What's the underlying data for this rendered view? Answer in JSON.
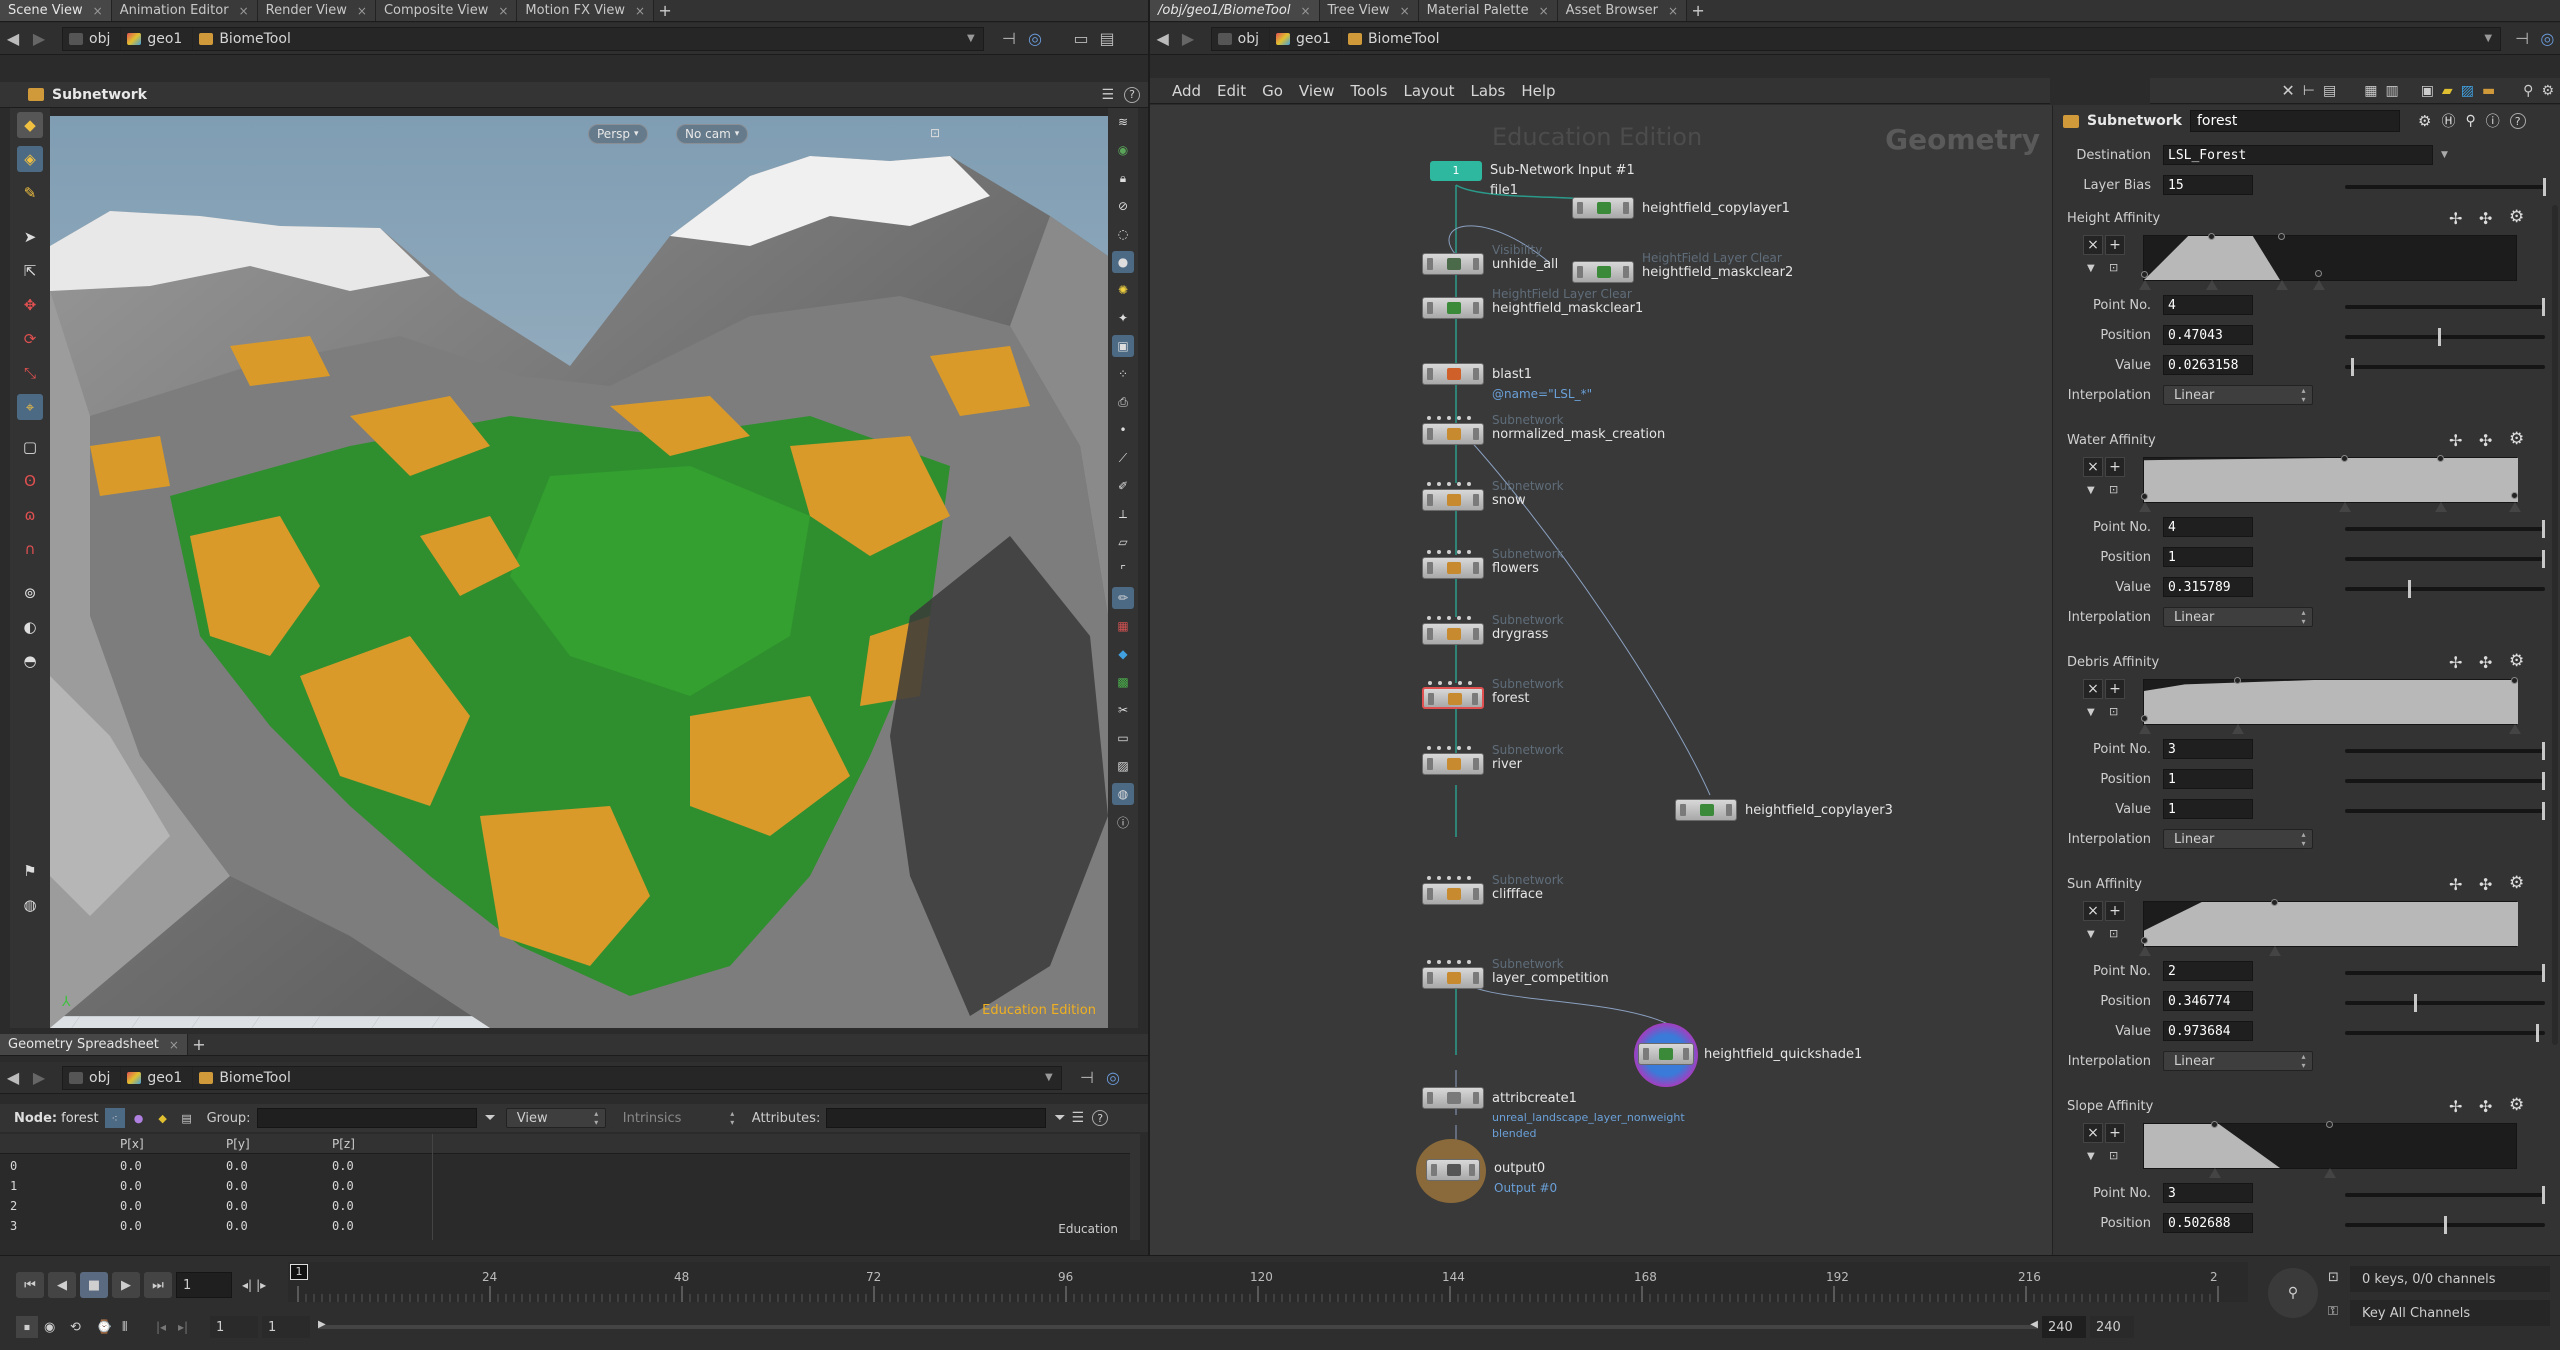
{
  "left_tabs": [
    "Scene View",
    "Animation Editor",
    "Render View",
    "Composite View",
    "Motion FX View"
  ],
  "right_tabs": [
    "/obj/geo1/BiomeTool",
    "Tree View",
    "Material Palette",
    "Asset Browser"
  ],
  "path": {
    "obj": "obj",
    "geo": "geo1",
    "tool": "BiomeTool"
  },
  "viewport": {
    "header_title": "Subnetwork",
    "persp_label": "Persp",
    "cam_label": "No cam",
    "watermark": "Education Edition"
  },
  "spreadsheet": {
    "tab": "Geometry Spreadsheet",
    "node_label": "Node:",
    "node_value": "forest",
    "group_label": "Group:",
    "view_label": "View",
    "intrinsics_label": "Intrinsics",
    "attributes_label": "Attributes:",
    "columns": [
      "P[x]",
      "P[y]",
      "P[z]"
    ],
    "rows": [
      {
        "idx": "0",
        "x": "0.0",
        "y": "0.0",
        "z": "0.0"
      },
      {
        "idx": "1",
        "x": "0.0",
        "y": "0.0",
        "z": "0.0"
      },
      {
        "idx": "2",
        "x": "0.0",
        "y": "0.0",
        "z": "0.0"
      },
      {
        "idx": "3",
        "x": "0.0",
        "y": "0.0",
        "z": "0.0"
      }
    ],
    "footer": "Education"
  },
  "network": {
    "menus": [
      "Add",
      "Edit",
      "Go",
      "View",
      "Tools",
      "Layout",
      "Labs",
      "Help"
    ],
    "watermark": "Education Edition",
    "context_label": "Geometry",
    "subnet_input": {
      "label": "Sub-Network Input #1",
      "sub": "file1",
      "badge": "1"
    },
    "nodes": {
      "copylayer1": "heightfield_copylayer1",
      "unhide_type": "Visibility",
      "unhide": "unhide_all",
      "maskclear2_type": "HeightField Layer Clear",
      "maskclear2": "heightfield_maskclear2",
      "maskclear1_type": "HeightField Layer Clear",
      "maskclear1": "heightfield_maskclear1",
      "blast": "blast1",
      "blast_note": "@name=\"LSL_*\"",
      "subnet_type": "Subnetwork",
      "normalized": "normalized_mask_creation",
      "snow": "snow",
      "flowers": "flowers",
      "drygrass": "drygrass",
      "forest": "forest",
      "river": "river",
      "copylayer3": "heightfield_copylayer3",
      "cliffface": "cliffface",
      "layer_competition": "layer_competition",
      "quickshade": "heightfield_quickshade1",
      "attribcreate": "attribcreate1",
      "attrib_note1": "unreal_landscape_layer_nonweight",
      "attrib_note2": "blended",
      "output": "output0",
      "output_note": "Output #0"
    }
  },
  "params": {
    "type_label": "Subnetwork",
    "node_name": "forest",
    "destination_label": "Destination",
    "destination_value": "LSL_Forest",
    "layer_bias_label": "Layer Bias",
    "layer_bias_value": "15",
    "labels": {
      "point": "Point No.",
      "position": "Position",
      "value": "Value",
      "interp": "Interpolation"
    },
    "height": {
      "title": "Height Affinity",
      "point": "4",
      "position": "0.47043",
      "value": "0.0263158",
      "interp": "Linear"
    },
    "water": {
      "title": "Water Affinity",
      "point": "4",
      "position": "1",
      "value": "0.315789",
      "interp": "Linear"
    },
    "debris": {
      "title": "Debris Affinity",
      "point": "3",
      "position": "1",
      "value": "1",
      "interp": "Linear"
    },
    "sun": {
      "title": "Sun Affinity",
      "point": "2",
      "position": "0.346774",
      "value": "0.973684",
      "interp": "Linear"
    },
    "slope": {
      "title": "Slope Affinity",
      "point": "3",
      "position": "0.502688"
    }
  },
  "timeline": {
    "current_frame": "1",
    "marker": "1",
    "ticks": [
      "24",
      "48",
      "72",
      "96",
      "120",
      "144",
      "168",
      "192",
      "216",
      "2"
    ],
    "start": "1",
    "start2": "1",
    "end": "240",
    "end2": "240",
    "keys_label": "0 keys, 0/0 channels",
    "key_all": "Key All Channels"
  }
}
